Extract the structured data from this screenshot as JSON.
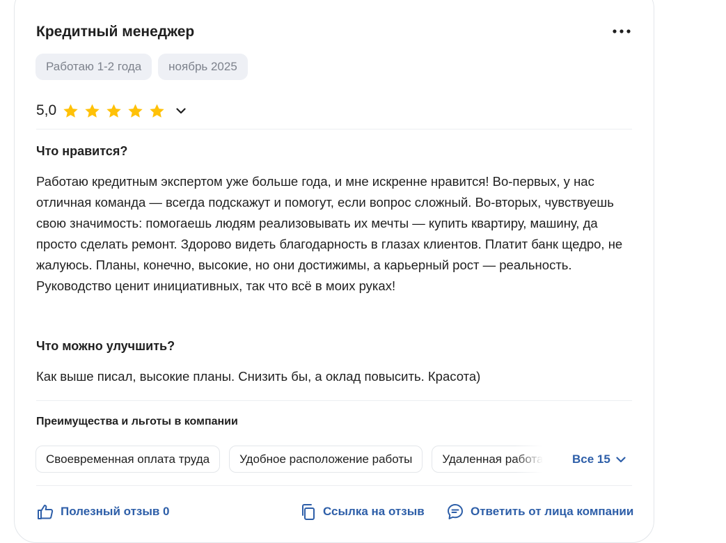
{
  "review": {
    "title": "Кредитный менеджер",
    "tags": [
      "Работаю 1-2 года",
      "ноябрь 2025"
    ],
    "rating": "5,0",
    "stars": 5,
    "likes_heading": "Что нравится?",
    "likes_text": "Работаю кредитным экспертом уже больше года, и мне искренне нравится! Во-первых, у нас отличная команда — всегда подскажут и помогут, если вопрос сложный. Во-вторых, чувствуешь свою значимость: помогаешь людям реализовывать их мечты — купить квартиру, машину, да просто сделать ремонт. Здорово видеть благодарность в глазах клиентов. Платит банк щедро, не жалуюсь. Планы, конечно, высокие, но они достижимы, а карьерный рост — реальность. Руководство ценит инициативных, так что всё в моих руках!",
    "improve_heading": "Что можно улучшить?",
    "improve_text": "Как выше писал, высокие планы. Снизить бы, а оклад повысить. Красота)"
  },
  "benefits": {
    "heading": "Преимущества и льготы в компании",
    "items": [
      "Своевременная оплата труда",
      "Удобное расположение работы",
      "Удаленная работа"
    ],
    "all_label": "Все 15"
  },
  "footer": {
    "useful_label": "Полезный отзыв 0",
    "link_label": "Ссылка на отзыв",
    "reply_label": "Ответить от лица компании"
  },
  "colors": {
    "accent": "#2d5ea8",
    "star": "#ffc107",
    "tag_bg": "#eef0f5",
    "tag_text": "#7d828c"
  },
  "icons": {
    "more": "more-dots-icon",
    "chevron": "chevron-down-icon",
    "useful": "thumbs-up-icon",
    "link": "copy-link-icon",
    "reply": "chat-bubble-icon"
  }
}
